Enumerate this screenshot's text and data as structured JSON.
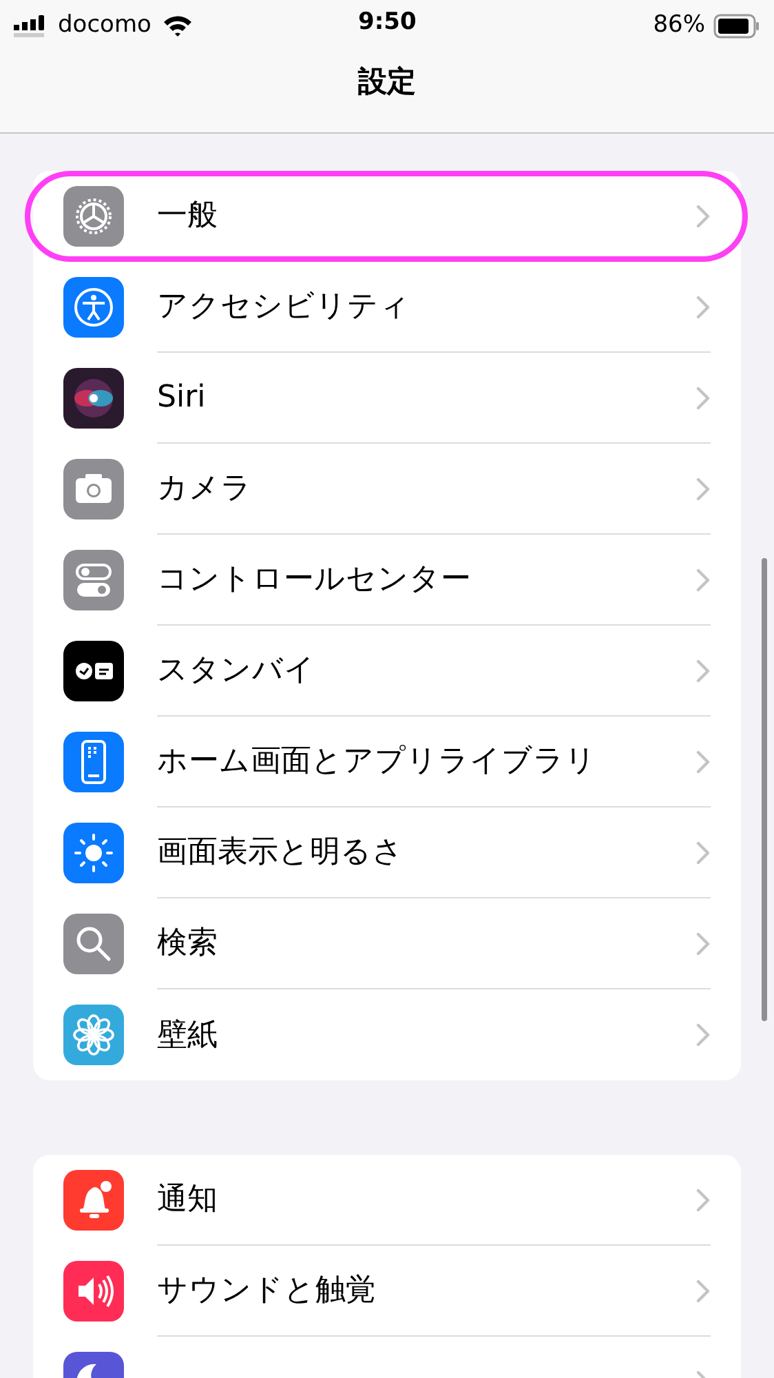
{
  "status_bar": {
    "carrier": "docomo",
    "time": "9:50",
    "battery": "86%"
  },
  "title": "設定",
  "groups": [
    {
      "items": [
        {
          "label": "一般",
          "color": "#8e8e93",
          "highlighted": true
        },
        {
          "label": "アクセシビリティ",
          "color": "#0a7aff",
          "highlighted": false
        },
        {
          "label": "Siri",
          "color": "#2a1a2e",
          "highlighted": false
        },
        {
          "label": "カメラ",
          "color": "#8e8e93",
          "highlighted": false
        },
        {
          "label": "コントロールセンター",
          "color": "#8e8e93",
          "highlighted": false
        },
        {
          "label": "スタンバイ",
          "color": "#000000",
          "highlighted": false
        },
        {
          "label": "ホーム画面とアプリライブラリ",
          "color": "#0a7aff",
          "highlighted": false
        },
        {
          "label": "画面表示と明るさ",
          "color": "#0a7aff",
          "highlighted": false
        },
        {
          "label": "検索",
          "color": "#8e8e93",
          "highlighted": false
        },
        {
          "label": "壁紙",
          "color": "#34aadc",
          "highlighted": false
        }
      ]
    },
    {
      "items": [
        {
          "label": "通知",
          "color": "#ff3b30",
          "highlighted": false
        },
        {
          "label": "サウンドと触覚",
          "color": "#ff2d55",
          "highlighted": false
        },
        {
          "color": "#5856d6",
          "highlighted": false
        }
      ]
    }
  ]
}
